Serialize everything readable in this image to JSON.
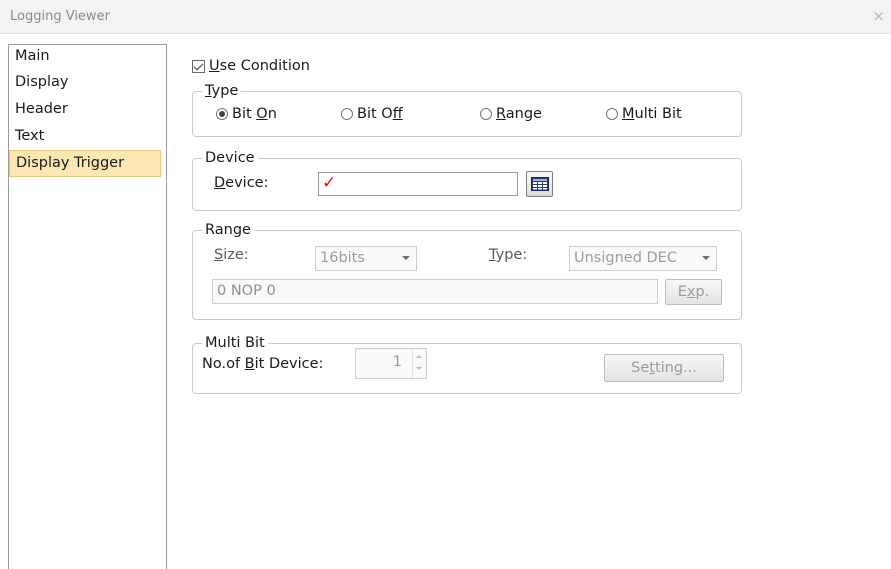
{
  "window": {
    "title": "Logging Viewer",
    "close_glyph": "×"
  },
  "nav": {
    "items": [
      {
        "label": "Main",
        "selected": false
      },
      {
        "label": "Display",
        "selected": false
      },
      {
        "label": "Header",
        "selected": false
      },
      {
        "label": "Text",
        "selected": false
      },
      {
        "label": "Display Trigger",
        "selected": true
      }
    ]
  },
  "use_condition": {
    "label_key": "U",
    "label_rest": "se Condition",
    "checked": true
  },
  "type_group": {
    "legend_key": "T",
    "legend_rest": "ype",
    "options": [
      {
        "pre": "Bit ",
        "key": "O",
        "post": "n",
        "selected": true
      },
      {
        "pre": "Bit O",
        "key": "f",
        "post": "f",
        "selected": false
      },
      {
        "pre": "",
        "key": "R",
        "post": "ange",
        "selected": false
      },
      {
        "pre": "",
        "key": "M",
        "post": "ulti Bit",
        "selected": false
      }
    ]
  },
  "device_group": {
    "legend": "Device",
    "label_key": "D",
    "label_rest": "evice:",
    "value": "✓",
    "browse_icon": "device-list-icon"
  },
  "range_group": {
    "legend": "Range",
    "size_key": "S",
    "size_rest": "ize:",
    "size_value": "16bits",
    "type_key": "T",
    "type_rest": "ype:",
    "type_value": "Unsigned DEC",
    "formula": "0 NOP 0",
    "exp_pre": "E",
    "exp_key": "x",
    "exp_post": "p."
  },
  "multibit_group": {
    "legend": "Multi Bit",
    "label_pre": "No.of ",
    "label_key": "B",
    "label_post": "it Device:",
    "count": "1",
    "setting_pre": "Se",
    "setting_key": "t",
    "setting_post": "ting..."
  },
  "colors": {
    "selection_bg": "#fde8b4",
    "selection_border": "#e9c978",
    "device_mark": "#e01010",
    "disabled_text": "#9c9c9c"
  }
}
